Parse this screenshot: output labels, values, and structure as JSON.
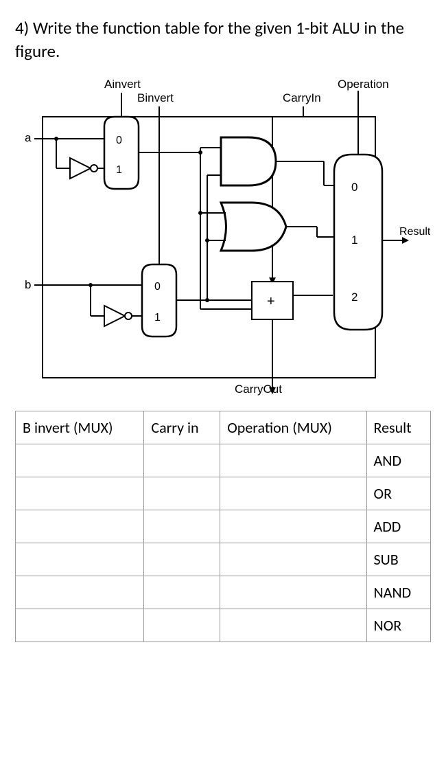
{
  "question": "4) Write the function table for the given 1-bit ALU in the figure.",
  "diagram": {
    "labels": {
      "ainvert": "Ainvert",
      "binvert": "Binvert",
      "carryin": "CarryIn",
      "operation": "Operation",
      "carryout": "CarryOut",
      "result": "Result",
      "a": "a",
      "b": "b",
      "plus": "+",
      "mux_a_0": "0",
      "mux_a_1": "1",
      "mux_b_0": "0",
      "mux_b_1": "1",
      "op_0": "0",
      "op_1": "1",
      "op_2": "2"
    }
  },
  "table": {
    "headers": [
      "B invert (MUX)",
      "Carry in",
      "Operation (MUX)",
      "Result"
    ],
    "rows": [
      [
        "",
        "",
        "",
        "AND"
      ],
      [
        "",
        "",
        "",
        "OR"
      ],
      [
        "",
        "",
        "",
        "ADD"
      ],
      [
        "",
        "",
        "",
        "SUB"
      ],
      [
        "",
        "",
        "",
        "NAND"
      ],
      [
        "",
        "",
        "",
        "NOR"
      ]
    ]
  }
}
